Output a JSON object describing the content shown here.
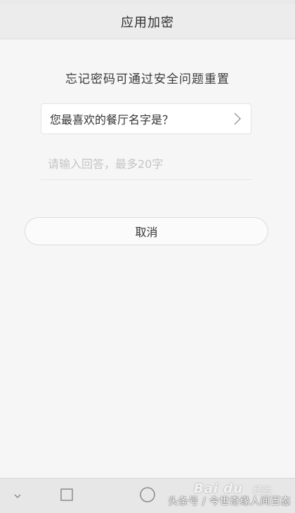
{
  "header": {
    "title": "应用加密"
  },
  "main": {
    "instruction": "忘记密码可通过安全问题重置",
    "security_question": {
      "selected": "您最喜欢的餐厅名字是？",
      "icon": "chevron-right-icon"
    },
    "answer": {
      "value": "",
      "placeholder": "请输入回答，最多20字"
    },
    "cancel_label": "取消"
  },
  "nav_bar": {
    "back_icon": "chevron-down-icon",
    "recent_icon": "square-icon",
    "home_icon": "circle-icon",
    "watermark_logo": "Bai du",
    "watermark_sub": "经验",
    "watermark_text": "头条号 / 今世奇缘人间百态"
  },
  "colors": {
    "background": "#f6f6f6",
    "header_background": "#ececec",
    "nav_background": "#e7e7e7",
    "text_primary": "#333333",
    "placeholder": "#c4c4c4"
  }
}
